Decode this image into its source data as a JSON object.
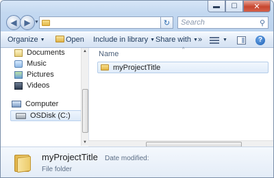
{
  "search": {
    "placeholder": "Search"
  },
  "toolbar": {
    "organize": "Organize",
    "open": "Open",
    "include": "Include in library",
    "share": "Share with",
    "more": "»"
  },
  "nav": {
    "items": [
      {
        "label": "Documents",
        "icon": "documents-icon"
      },
      {
        "label": "Music",
        "icon": "music-icon"
      },
      {
        "label": "Pictures",
        "icon": "pictures-icon"
      },
      {
        "label": "Videos",
        "icon": "videos-icon"
      },
      {
        "label": "Computer",
        "icon": "computer-icon"
      },
      {
        "label": "OSDisk (C:)",
        "icon": "disk-icon"
      }
    ]
  },
  "content": {
    "column_name": "Name",
    "files": [
      {
        "name": "myProjectTitle",
        "icon": "folder-icon"
      }
    ]
  },
  "details": {
    "name": "myProjectTitle",
    "modified_label": "Date modified:",
    "type": "File folder"
  }
}
